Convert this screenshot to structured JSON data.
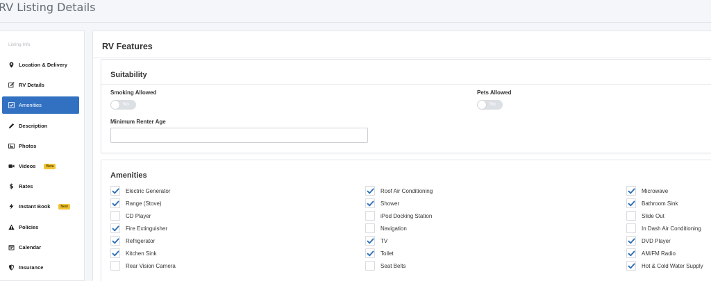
{
  "header": {
    "title": "RV Listing Details"
  },
  "sidebar": {
    "heading": "Listing Info",
    "items": [
      {
        "label": "Location & Delivery",
        "icon": "map-marker-icon",
        "active": false,
        "badge": ""
      },
      {
        "label": "RV Details",
        "icon": "edit-icon",
        "active": false,
        "badge": ""
      },
      {
        "label": "Amenities",
        "icon": "check-square-icon",
        "active": true,
        "badge": ""
      },
      {
        "label": "Description",
        "icon": "pencil-icon",
        "active": false,
        "badge": ""
      },
      {
        "label": "Photos",
        "icon": "image-icon",
        "active": false,
        "badge": ""
      },
      {
        "label": "Videos",
        "icon": "video-camera-icon",
        "active": false,
        "badge": "Beta"
      },
      {
        "label": "Rates",
        "icon": "dollar-icon",
        "active": false,
        "badge": ""
      },
      {
        "label": "Instant Book",
        "icon": "lightning-bolt-icon",
        "active": false,
        "badge": "New"
      },
      {
        "label": "Policies",
        "icon": "warning-icon",
        "active": false,
        "badge": ""
      },
      {
        "label": "Calendar",
        "icon": "calendar-icon",
        "active": false,
        "badge": ""
      },
      {
        "label": "Insurance",
        "icon": "shield-icon",
        "active": false,
        "badge": ""
      }
    ]
  },
  "main": {
    "title": "RV Features",
    "suitability": {
      "title": "Suitability",
      "smoking_label": "Smoking Allowed",
      "smoking_value": "No",
      "pets_label": "Pets Allowed",
      "pets_value": "No",
      "min_age_label": "Minimum Renter Age",
      "min_age_value": ""
    },
    "amenities": {
      "title": "Amenities",
      "columns": [
        [
          {
            "label": "Electric Generator",
            "checked": true
          },
          {
            "label": "Range (Stove)",
            "checked": true
          },
          {
            "label": "CD Player",
            "checked": false
          },
          {
            "label": "Fire Extinguisher",
            "checked": true
          },
          {
            "label": "Refrigerator",
            "checked": true
          },
          {
            "label": "Kitchen Sink",
            "checked": true
          },
          {
            "label": "Rear Vision Camera",
            "checked": false
          }
        ],
        [
          {
            "label": "Roof Air Conditioning",
            "checked": true
          },
          {
            "label": "Shower",
            "checked": true
          },
          {
            "label": "iPod Docking Station",
            "checked": false
          },
          {
            "label": "Navigation",
            "checked": false
          },
          {
            "label": "TV",
            "checked": true
          },
          {
            "label": "Toilet",
            "checked": true
          },
          {
            "label": "Seat Belts",
            "checked": false
          }
        ],
        [
          {
            "label": "Microwave",
            "checked": true
          },
          {
            "label": "Bathroom Sink",
            "checked": true
          },
          {
            "label": "Slide Out",
            "checked": false
          },
          {
            "label": "In Dash Air Conditioning",
            "checked": false
          },
          {
            "label": "DVD Player",
            "checked": true
          },
          {
            "label": "AM/FM Radio",
            "checked": true
          },
          {
            "label": "Hot & Cold Water Supply",
            "checked": true
          }
        ]
      ]
    }
  },
  "colors": {
    "accent": "#3271c2",
    "check": "#2d6fb8",
    "badge": "#f0c433"
  }
}
